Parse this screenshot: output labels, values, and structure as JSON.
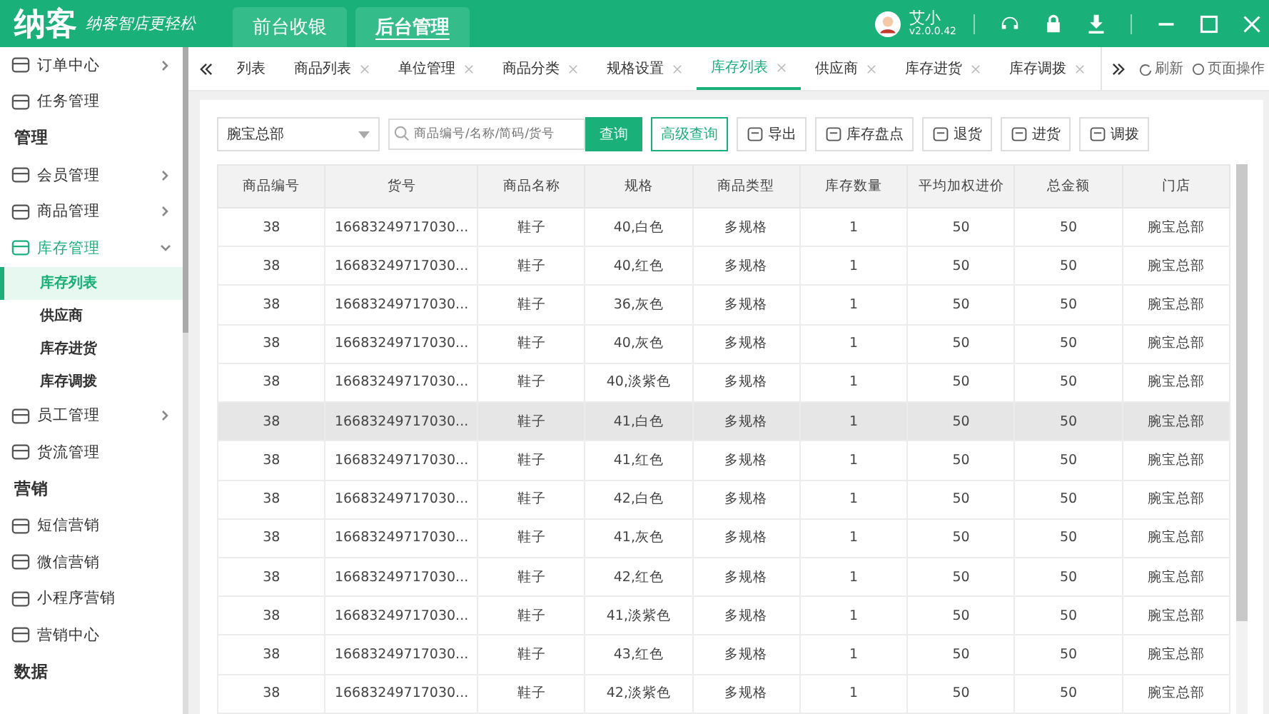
{
  "header": {
    "logo": "纳客",
    "slogan": "纳客智店更轻松",
    "nav": [
      {
        "label": "前台收银",
        "selected": false
      },
      {
        "label": "后台管理",
        "selected": true
      }
    ],
    "user": {
      "name": "艾小",
      "version": "v2.0.0.42"
    }
  },
  "sidebar": [
    {
      "kind": "item",
      "label": "订单中心",
      "arrow": true
    },
    {
      "kind": "item",
      "label": "任务管理",
      "arrow": false
    },
    {
      "kind": "section",
      "label": "管理"
    },
    {
      "kind": "item",
      "label": "会员管理",
      "arrow": true
    },
    {
      "kind": "item",
      "label": "商品管理",
      "arrow": true
    },
    {
      "kind": "item",
      "label": "库存管理",
      "arrow": true,
      "expanded": true,
      "children": [
        {
          "label": "库存列表",
          "selected": true
        },
        {
          "label": "供应商",
          "selected": false
        },
        {
          "label": "库存进货",
          "selected": false
        },
        {
          "label": "库存调拨",
          "selected": false
        }
      ]
    },
    {
      "kind": "item",
      "label": "员工管理",
      "arrow": true
    },
    {
      "kind": "item",
      "label": "货流管理",
      "arrow": false
    },
    {
      "kind": "section",
      "label": "营销"
    },
    {
      "kind": "item",
      "label": "短信营销",
      "arrow": false
    },
    {
      "kind": "item",
      "label": "微信营销",
      "arrow": false
    },
    {
      "kind": "item",
      "label": "小程序营销",
      "arrow": false
    },
    {
      "kind": "item",
      "label": "营销中心",
      "arrow": false
    },
    {
      "kind": "section",
      "label": "数据"
    }
  ],
  "tabs": [
    {
      "label": "列表",
      "selected": false,
      "closable": false
    },
    {
      "label": "商品列表",
      "selected": false,
      "closable": true
    },
    {
      "label": "单位管理",
      "selected": false,
      "closable": true
    },
    {
      "label": "商品分类",
      "selected": false,
      "closable": true
    },
    {
      "label": "规格设置",
      "selected": false,
      "closable": true
    },
    {
      "label": "库存列表",
      "selected": true,
      "closable": true
    },
    {
      "label": "供应商",
      "selected": false,
      "closable": true
    },
    {
      "label": "库存进货",
      "selected": false,
      "closable": true
    },
    {
      "label": "库存调拨",
      "selected": false,
      "closable": true
    }
  ],
  "tab_actions": {
    "refresh": "刷新",
    "page_ops": "页面操作"
  },
  "toolbar": {
    "store": "腕宝总部",
    "search_placeholder": "商品编号/名称/简码/货号",
    "search_button": "查询",
    "advanced": "高级查询",
    "buttons": [
      "导出",
      "库存盘点",
      "退货",
      "进货",
      "调拨"
    ]
  },
  "table": {
    "columns": [
      "商品编号",
      "货号",
      "商品名称",
      "规格",
      "商品类型",
      "库存数量",
      "平均加权进价",
      "总金额",
      "门店"
    ],
    "rows": [
      {
        "selected": false,
        "cells": [
          "38",
          "16683249717030...",
          "鞋子",
          "40,白色",
          "多规格",
          "1",
          "50",
          "50",
          "腕宝总部"
        ]
      },
      {
        "selected": false,
        "cells": [
          "38",
          "16683249717030...",
          "鞋子",
          "40,红色",
          "多规格",
          "1",
          "50",
          "50",
          "腕宝总部"
        ]
      },
      {
        "selected": false,
        "cells": [
          "38",
          "16683249717030...",
          "鞋子",
          "36,灰色",
          "多规格",
          "1",
          "50",
          "50",
          "腕宝总部"
        ]
      },
      {
        "selected": false,
        "cells": [
          "38",
          "16683249717030...",
          "鞋子",
          "40,灰色",
          "多规格",
          "1",
          "50",
          "50",
          "腕宝总部"
        ]
      },
      {
        "selected": false,
        "cells": [
          "38",
          "16683249717030...",
          "鞋子",
          "40,淡紫色",
          "多规格",
          "1",
          "50",
          "50",
          "腕宝总部"
        ]
      },
      {
        "selected": true,
        "cells": [
          "38",
          "16683249717030...",
          "鞋子",
          "41,白色",
          "多规格",
          "1",
          "50",
          "50",
          "腕宝总部"
        ]
      },
      {
        "selected": false,
        "cells": [
          "38",
          "16683249717030...",
          "鞋子",
          "41,红色",
          "多规格",
          "1",
          "50",
          "50",
          "腕宝总部"
        ]
      },
      {
        "selected": false,
        "cells": [
          "38",
          "16683249717030...",
          "鞋子",
          "42,白色",
          "多规格",
          "1",
          "50",
          "50",
          "腕宝总部"
        ]
      },
      {
        "selected": false,
        "cells": [
          "38",
          "16683249717030...",
          "鞋子",
          "41,灰色",
          "多规格",
          "1",
          "50",
          "50",
          "腕宝总部"
        ]
      },
      {
        "selected": false,
        "cells": [
          "38",
          "16683249717030...",
          "鞋子",
          "42,红色",
          "多规格",
          "1",
          "50",
          "50",
          "腕宝总部"
        ]
      },
      {
        "selected": false,
        "cells": [
          "38",
          "16683249717030...",
          "鞋子",
          "41,淡紫色",
          "多规格",
          "1",
          "50",
          "50",
          "腕宝总部"
        ]
      },
      {
        "selected": false,
        "cells": [
          "38",
          "16683249717030...",
          "鞋子",
          "43,红色",
          "多规格",
          "1",
          "50",
          "50",
          "腕宝总部"
        ]
      },
      {
        "selected": false,
        "cells": [
          "38",
          "16683249717030...",
          "鞋子",
          "42,淡紫色",
          "多规格",
          "1",
          "50",
          "50",
          "腕宝总部"
        ]
      }
    ]
  }
}
